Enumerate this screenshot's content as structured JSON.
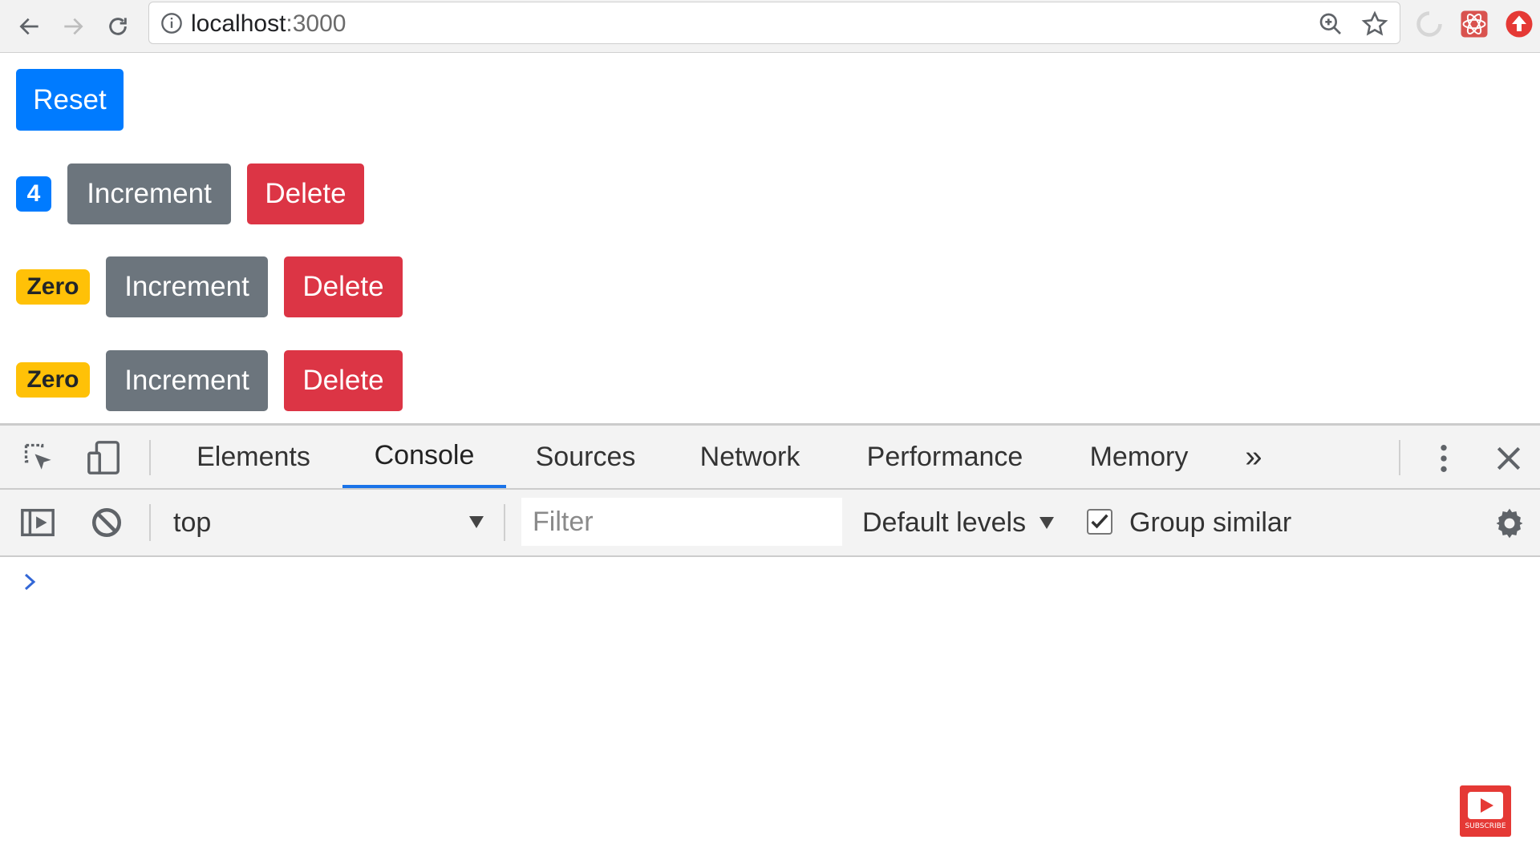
{
  "browser": {
    "url_host": "localhost",
    "url_port": ":3000"
  },
  "page": {
    "reset_label": "Reset",
    "counters": [
      {
        "badge": "4",
        "badge_color": "#007bff",
        "increment_label": "Increment",
        "delete_label": "Delete"
      },
      {
        "badge": "Zero",
        "badge_color": "#ffc107",
        "increment_label": "Increment",
        "delete_label": "Delete"
      },
      {
        "badge": "Zero",
        "badge_color": "#ffc107",
        "increment_label": "Increment",
        "delete_label": "Delete"
      }
    ]
  },
  "devtools": {
    "tabs": [
      "Elements",
      "Console",
      "Sources",
      "Network",
      "Performance",
      "Memory"
    ],
    "active_tab": "Console",
    "more_tabs_glyph": "»",
    "console": {
      "context": "top",
      "filter_placeholder": "Filter",
      "levels_label": "Default levels",
      "group_similar_label": "Group similar",
      "group_similar_checked": true
    }
  },
  "overlay": {
    "subscribe_text": "SUBSCRIBE"
  }
}
